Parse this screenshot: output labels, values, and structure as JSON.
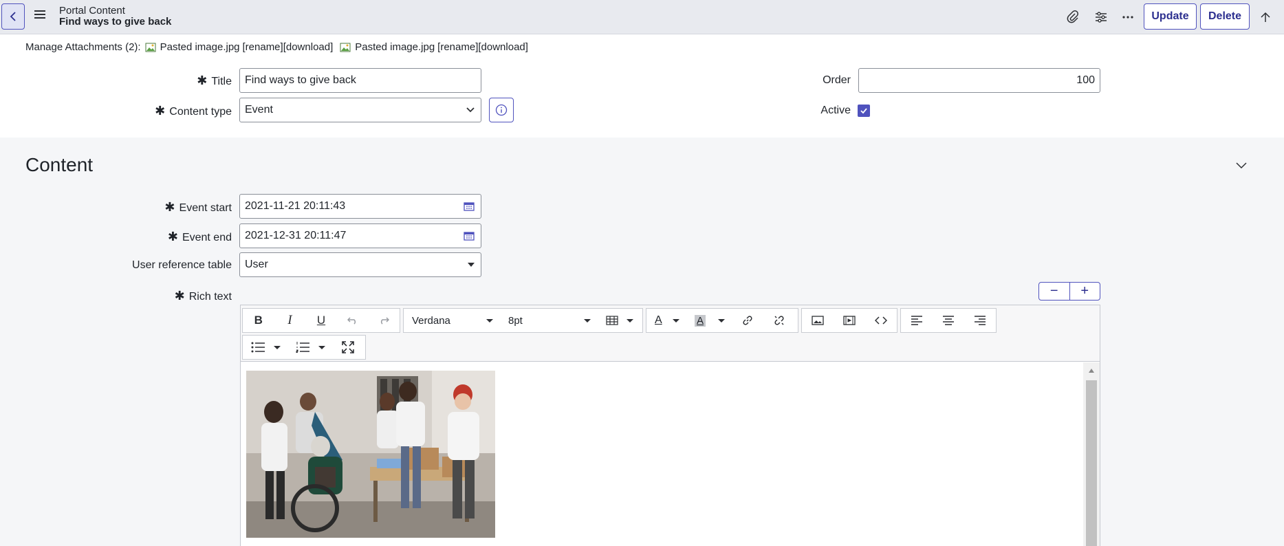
{
  "header": {
    "breadcrumb": "Portal Content",
    "record_title": "Find ways to give back",
    "update_label": "Update",
    "delete_label": "Delete"
  },
  "attachments": {
    "label": "Manage Attachments (2):",
    "items": [
      {
        "name": "Pasted image.jpg",
        "rename": "[rename]",
        "download": "[download]"
      },
      {
        "name": "Pasted image.jpg",
        "rename": "[rename]",
        "download": "[download]"
      }
    ]
  },
  "form": {
    "title_label": "Title",
    "title_value": "Find ways to give back",
    "content_type_label": "Content type",
    "content_type_value": "Event",
    "order_label": "Order",
    "order_value": "100",
    "active_label": "Active",
    "active_checked": true
  },
  "content_section": {
    "heading": "Content",
    "event_start_label": "Event start",
    "event_start_value": "2021-11-21 20:11:43",
    "event_end_label": "Event end",
    "event_end_value": "2021-12-31 20:11:47",
    "user_ref_label": "User reference table",
    "user_ref_value": "User",
    "rich_text_label": "Rich text"
  },
  "editor": {
    "font_family": "Verdana",
    "font_size": "8pt",
    "size_minus": "−",
    "size_plus": "+"
  },
  "colors": {
    "accent": "#4f52bd",
    "header_bg": "#e8eaef",
    "page_bg": "#f5f6f8"
  }
}
